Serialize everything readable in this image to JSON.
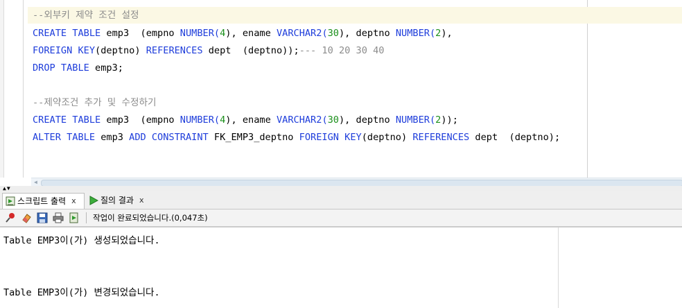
{
  "editor": {
    "comment1": "--외부키 제약 조건 설정",
    "create1": {
      "kw1": "CREATE TABLE",
      "t1": " emp3  (empno ",
      "k_num1": "NUMBER",
      "p1": "(",
      "n4": "4",
      "p2": "), ename ",
      "k_vc": "VARCHAR2",
      "p3": "(",
      "n30": "30",
      "p4": "), deptno ",
      "k_num2": "NUMBER",
      "p5": "(",
      "n2": "2",
      "p6": "),"
    },
    "foreign1": {
      "kw1": "FOREIGN KEY",
      "t1": "(deptno) ",
      "kw2": "REFERENCES",
      "t2": " dept  (deptno));",
      "cmt": "--- 10 20 30 40"
    },
    "drop": {
      "kw1": "DROP TABLE",
      "t1": " emp3;"
    },
    "comment2": "--제약조건 추가 및 수정하기",
    "create2": {
      "kw1": "CREATE TABLE",
      "t1": " emp3  (empno ",
      "k_num1": "NUMBER",
      "p1": "(",
      "n4": "4",
      "p2": "), ename ",
      "k_vc": "VARCHAR2",
      "p3": "(",
      "n30": "30",
      "p4": "), deptno ",
      "k_num2": "NUMBER",
      "p5": "(",
      "n2": "2",
      "p6": "));"
    },
    "alter": {
      "kw1": "ALTER TABLE",
      "t1": " emp3 ",
      "kw2": "ADD CONSTRAINT",
      "t2": " FK_EMP3_deptno ",
      "kw3": "FOREIGN KEY",
      "t3": "(deptno) ",
      "kw4": "REFERENCES",
      "t4": " dept  (deptno);"
    }
  },
  "tabs": [
    {
      "label": "스크립트 출력",
      "close": "x"
    },
    {
      "label": "질의 결과",
      "close": "x"
    }
  ],
  "toolbar": {
    "icons": [
      "pin-icon",
      "eraser-icon",
      "save-icon",
      "print-icon",
      "export-icon"
    ],
    "status": "작업이 완료되었습니다.(0,047초)"
  },
  "output": {
    "line1": "Table EMP3이(가) 생성되었습니다.",
    "line2": "Table EMP3이(가) 변경되었습니다."
  },
  "colors": {
    "keyword": "#1e3ddb",
    "number": "#1a8f1a",
    "comment": "#8c8c8c",
    "highlight": "#fbf8e4"
  }
}
